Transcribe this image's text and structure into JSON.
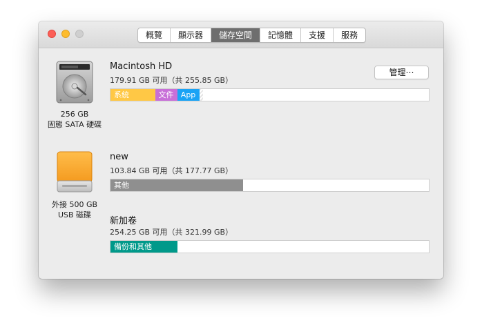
{
  "toolbar": {
    "tabs": [
      {
        "label": "概覽"
      },
      {
        "label": "顯示器"
      },
      {
        "label": "儲存空間"
      },
      {
        "label": "記憶體"
      },
      {
        "label": "支援"
      },
      {
        "label": "服務"
      }
    ],
    "active_tab": "儲存空間"
  },
  "drives": [
    {
      "icon": "internal-drive-icon",
      "caption_line1": "256 GB",
      "caption_line2": "固態 SATA 硬碟",
      "volumes": [
        {
          "name": "Macintosh HD",
          "detail": "179.91 GB 可用（共 255.85 GB）",
          "button": "管理⋯",
          "segments": [
            {
              "label": "系統",
              "color": "#ffc845",
              "fraction": 0.14
            },
            {
              "label": "文件",
              "color": "#c86fd8",
              "fraction": 0.07
            },
            {
              "label": "App",
              "color": "#1aa3f5",
              "fraction": 0.07
            },
            {
              "label": "",
              "color": "hatched",
              "fraction": 0.005
            }
          ]
        }
      ]
    },
    {
      "icon": "external-drive-icon",
      "caption_line1": "外接 500 GB",
      "caption_line2": "USB 磁碟",
      "volumes": [
        {
          "name": "new",
          "detail": "103.84 GB 可用（共 177.77 GB）",
          "segments": [
            {
              "label": "其他",
              "color": "#8f8f8f",
              "fraction": 0.416
            }
          ]
        },
        {
          "name": "新加卷",
          "detail": "254.25 GB 可用（共 321.99 GB）",
          "segments": [
            {
              "label": "備份和其他",
              "color": "#00998a",
              "fraction": 0.21
            }
          ]
        }
      ]
    }
  ]
}
